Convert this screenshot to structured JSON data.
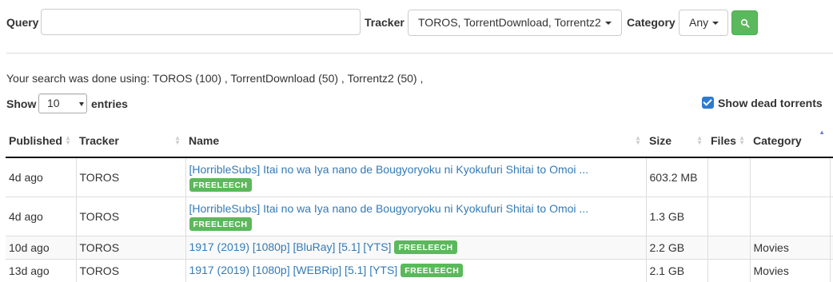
{
  "toolbar": {
    "query_label": "Query",
    "query_value": "",
    "tracker_label": "Tracker",
    "tracker_value": "TOROS, TorrentDownload, Torrentz2",
    "category_label": "Category",
    "category_value": "Any",
    "search_icon": "search-icon",
    "accent_color": "#5cb85c"
  },
  "info_text": "Your search was done using: TOROS (100) , TorrentDownload (50) , Torrentz2 (50) ,",
  "length": {
    "show_label": "Show",
    "value": "10",
    "entries_label": "entries"
  },
  "dead_torrents": {
    "label": "Show dead torrents",
    "checked": true
  },
  "table": {
    "columns": [
      "Published",
      "Tracker",
      "Name",
      "Size",
      "Files",
      "Category"
    ],
    "rows": [
      {
        "published": "4d ago",
        "tracker": "TOROS",
        "name": "[HorribleSubs] Itai no wa Iya nano de Bougyoryoku ni Kyokufuri Shitai to Omoi ...",
        "badge": "FREELEECH",
        "size": "603.2 MB",
        "files": "",
        "category": ""
      },
      {
        "published": "4d ago",
        "tracker": "TOROS",
        "name": "[HorribleSubs] Itai no wa Iya nano de Bougyoryoku ni Kyokufuri Shitai to Omoi ...",
        "badge": "FREELEECH",
        "size": "1.3 GB",
        "files": "",
        "category": ""
      },
      {
        "published": "10d ago",
        "tracker": "TOROS",
        "name": "1917 (2019) [1080p] [BluRay] [5.1] [YTS]",
        "badge": "FREELEECH",
        "size": "2.2 GB",
        "files": "",
        "category": "Movies"
      },
      {
        "published": "13d ago",
        "tracker": "TOROS",
        "name": "1917 (2019) [1080p] [WEBRip] [5.1] [YTS]",
        "badge": "FREELEECH",
        "size": "2.1 GB",
        "files": "",
        "category": "Movies"
      }
    ]
  }
}
